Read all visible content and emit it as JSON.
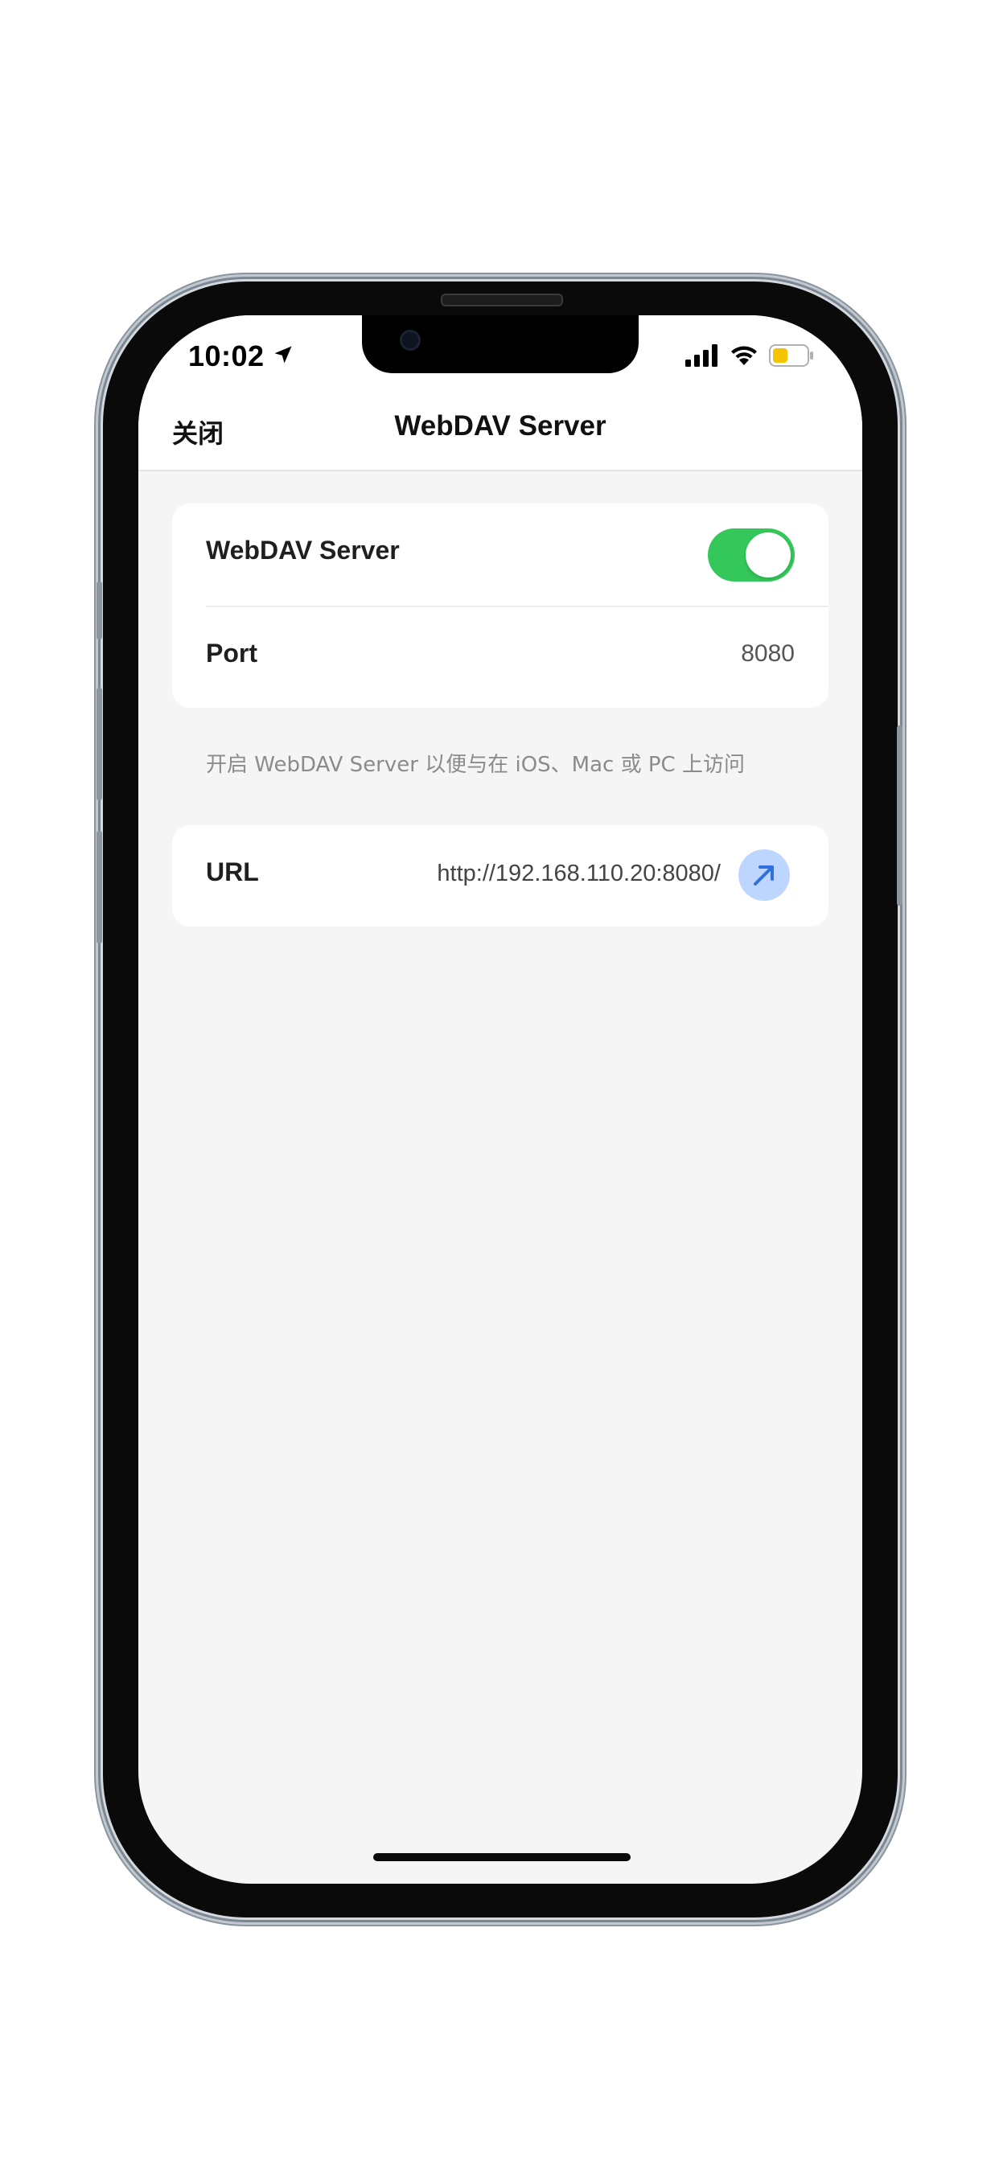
{
  "status_bar": {
    "time": "10:02",
    "icons": [
      "location-arrow-icon",
      "cellular-signal-icon",
      "wifi-icon",
      "battery-icon"
    ],
    "battery_color": "#f5c400"
  },
  "nav": {
    "close_label": "关闭",
    "title": "WebDAV Server"
  },
  "settings": {
    "server_label": "WebDAV Server",
    "server_enabled": true,
    "port_label": "Port",
    "port_value": "8080",
    "footnote": "开启 WebDAV Server 以便与在 iOS、Mac 或 PC 上访问"
  },
  "url_row": {
    "label": "URL",
    "value": "http://192.168.110.20:8080/",
    "action_icon": "arrow-up-right-icon"
  },
  "colors": {
    "toggle_on": "#34c759",
    "link_button_bg": "#bcd6ff",
    "link_arrow": "#2f6fe0",
    "background": "#f5f5f5"
  }
}
